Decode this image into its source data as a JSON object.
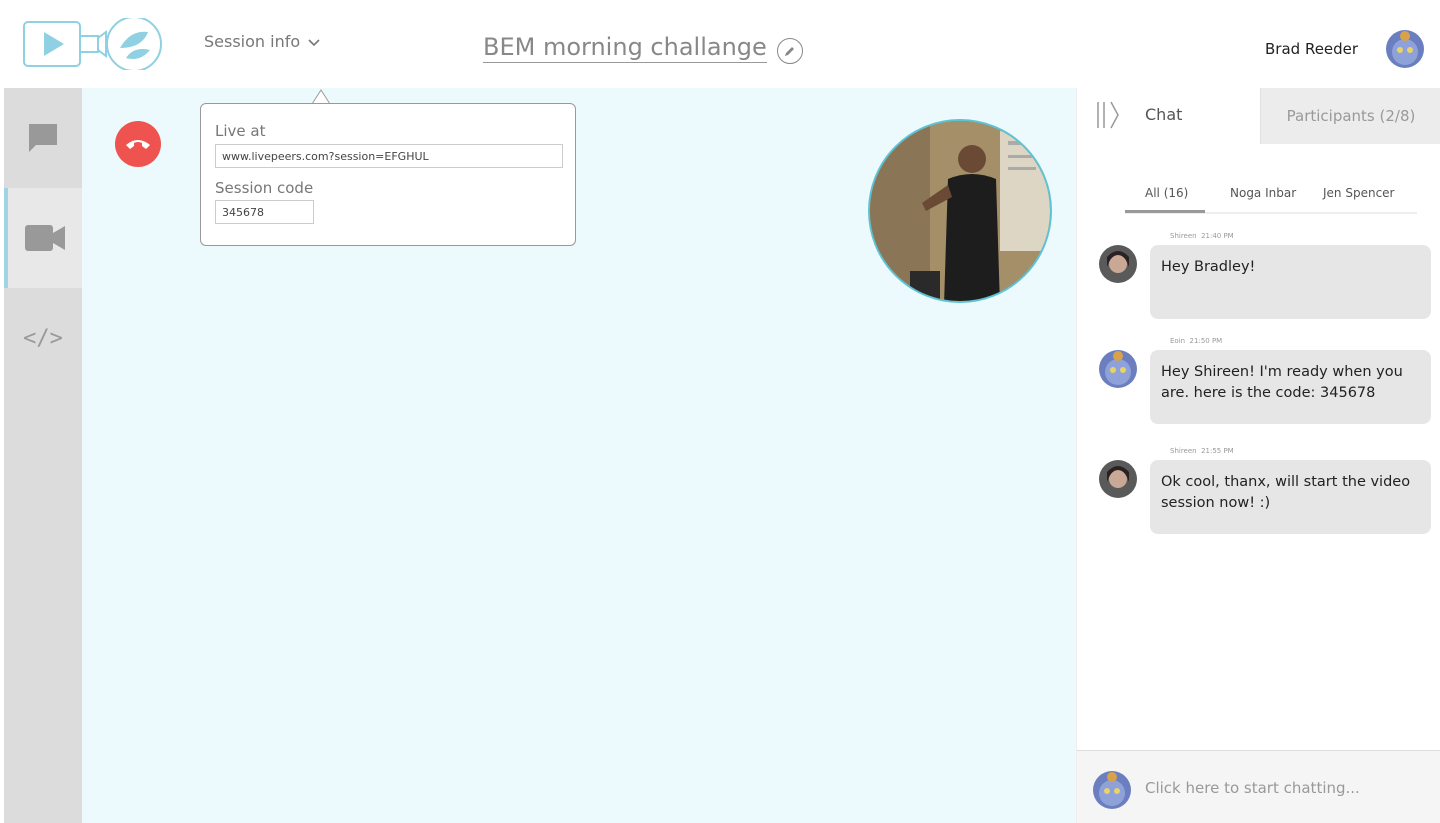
{
  "header": {
    "session_info_label": "Session info",
    "title": "BEM morning challange",
    "user_name": "Brad Reeder"
  },
  "nav": {
    "code_label": "</>"
  },
  "popover": {
    "live_at_label": "Live at",
    "live_at_value": "www.livepeers.com?session=EFGHUL",
    "session_code_label": "Session code",
    "session_code_value": "345678"
  },
  "chat_panel": {
    "tabs": [
      {
        "label": "Chat"
      },
      {
        "label": "Participants (2/8)"
      }
    ],
    "filters": [
      {
        "label": "All (16)",
        "active": true
      },
      {
        "label": "Noga Inbar"
      },
      {
        "label": "Jen Spencer"
      }
    ],
    "messages": [
      {
        "author": "Shireen",
        "time": "21:40 PM",
        "text": "Hey Bradley!"
      },
      {
        "author": "Eoin",
        "time": "21:50 PM",
        "text": "Hey Shireen! I'm ready when you are. here is the code:  345678"
      },
      {
        "author": "Shireen",
        "time": "21:55 PM",
        "text": "Ok cool, thanx, will start the video session now! :)"
      }
    ],
    "composer_placeholder": "Click here to start chatting..."
  },
  "colors": {
    "accent": "#9fd3e6",
    "video_bg": "#ecf9fd",
    "hangup": "#ef5350",
    "nav_bg": "#dcdcdc"
  }
}
